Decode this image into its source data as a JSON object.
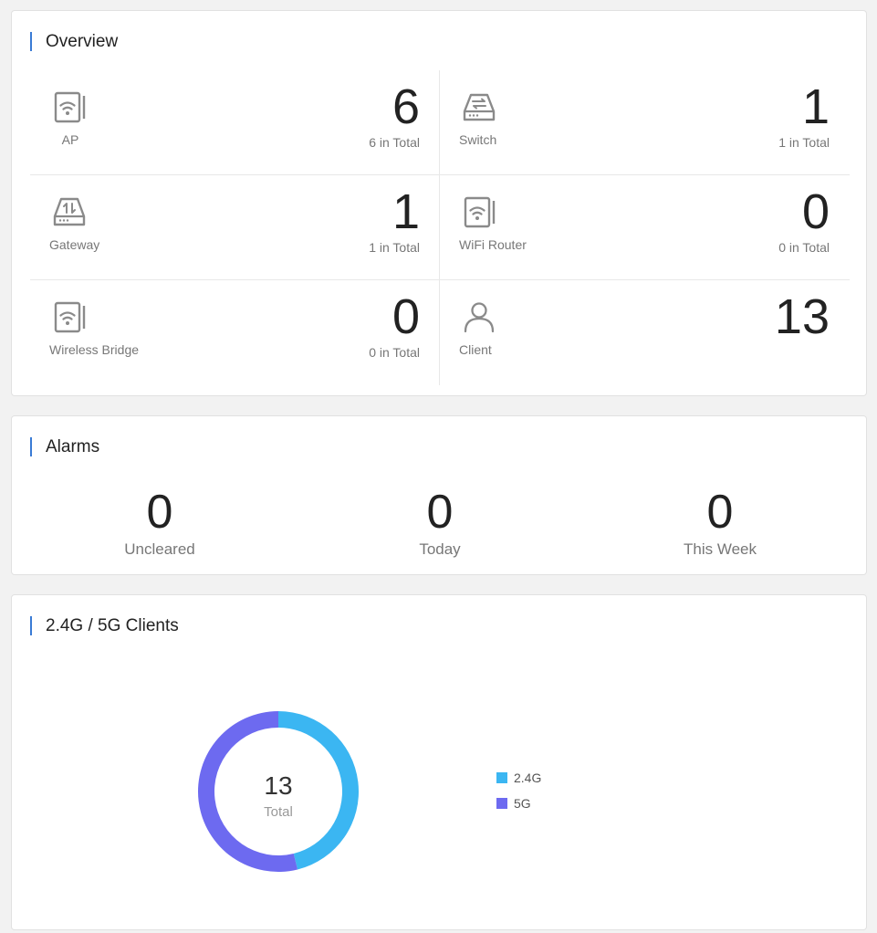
{
  "overview": {
    "title": "Overview",
    "devices": [
      {
        "label": "AP",
        "count": "6",
        "total": "6 in Total",
        "icon": "ap-icon"
      },
      {
        "label": "Switch",
        "count": "1",
        "total": "1 in Total",
        "icon": "switch-icon"
      },
      {
        "label": "Gateway",
        "count": "1",
        "total": "1 in Total",
        "icon": "gateway-icon"
      },
      {
        "label": "WiFi Router",
        "count": "0",
        "total": "0 in Total",
        "icon": "wifi-router-icon"
      },
      {
        "label": "Wireless Bridge",
        "count": "0",
        "total": "0 in Total",
        "icon": "wireless-bridge-icon"
      },
      {
        "label": "Client",
        "count": "13",
        "icon": "client-icon"
      }
    ]
  },
  "alarms": {
    "title": "Alarms",
    "items": [
      {
        "label": "Uncleared",
        "value": "0"
      },
      {
        "label": "Today",
        "value": "0"
      },
      {
        "label": "This Week",
        "value": "0"
      }
    ]
  },
  "clients_chart": {
    "title": "2.4G / 5G Clients",
    "center_value": "13",
    "center_label": "Total"
  },
  "colors": {
    "accent": "#3a7bd5",
    "band_24g": "#3bb6f2",
    "band_5g": "#6d6af0",
    "icon": "#8a8a8a"
  },
  "chart_data": {
    "type": "pie",
    "categories": [
      "2.4G",
      "5G"
    ],
    "values": [
      6,
      7
    ],
    "total": 13,
    "legend": "right"
  }
}
